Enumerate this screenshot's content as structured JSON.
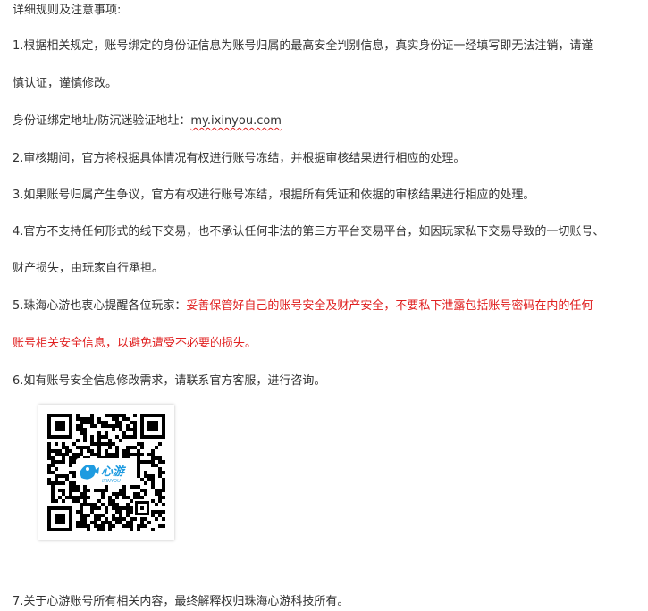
{
  "article": {
    "heading": "详细规则及注意事项:",
    "rule1_line1": "1.根据相关规定，账号绑定的身份证信息为账号归属的最高安全判别信息，真实身份证一经填写即无法注销，请谨",
    "rule1_line2": "慎认证，谨慎修改。",
    "id_binding_label": "身份证绑定地址/防沉迷验证地址：",
    "id_binding_url": "my.ixinyou.com",
    "rule2": "2.审核期间，官方将根据具体情况有权进行账号冻结，并根据审核结果进行相应的处理。",
    "rule3": "3.如果账号归属产生争议，官方有权进行账号冻结，根据所有凭证和依据的审核结果进行相应的处理。",
    "rule4_line1": "4.官方不支持任何形式的线下交易，也不承认任何非法的第三方平台交易平台，如因玩家私下交易导致的一切账号、",
    "rule4_line2": "财产损失，由玩家自行承担。",
    "rule5_prefix": "5.珠海心游也衷心提醒各位玩家：",
    "rule5_warning_line1": "妥善保管好自己的账号安全及财产安全，不要私下泄露包括账号密码在内的任何",
    "rule5_warning_line2": "账号相关安全信息，以避免遭受不必要的损失。",
    "rule6": "6.如有账号安全信息修改需求，请联系官方客服，进行咨询。",
    "rule7": "7.关于心游账号所有相关内容，最终解释权归珠海心游科技所有。"
  },
  "qr_code": {
    "logo_text": "心游",
    "logo_subtext": "IXINYOU",
    "logo_color": "#1e9be0"
  },
  "colors": {
    "text": "#333333",
    "warning": "#e02020"
  }
}
